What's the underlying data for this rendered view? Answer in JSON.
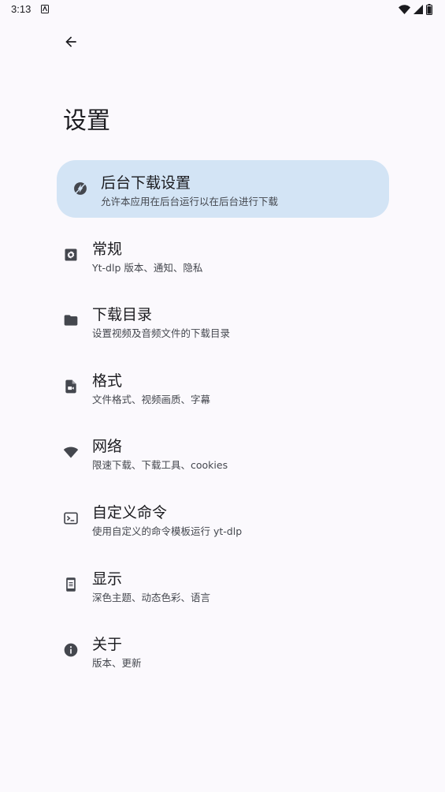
{
  "status_bar": {
    "time": "3:13"
  },
  "header": {
    "title": "设置"
  },
  "settings": [
    {
      "title": "后台下载设置",
      "description": "允许本应用在后台运行以在后台进行下载",
      "icon": "bolt-off-icon",
      "highlighted": true
    },
    {
      "title": "常规",
      "description": "Yt-dlp 版本、通知、隐私",
      "icon": "settings-gear-icon"
    },
    {
      "title": "下载目录",
      "description": "设置视频及音频文件的下载目录",
      "icon": "folder-icon"
    },
    {
      "title": "格式",
      "description": "文件格式、视频画质、字幕",
      "icon": "video-file-icon"
    },
    {
      "title": "网络",
      "description": "限速下载、下载工具、cookies",
      "icon": "wifi-icon"
    },
    {
      "title": "自定义命令",
      "description": "使用自定义的命令模板运行 yt-dlp",
      "icon": "terminal-icon"
    },
    {
      "title": "显示",
      "description": "深色主题、动态色彩、语言",
      "icon": "phone-display-icon"
    },
    {
      "title": "关于",
      "description": "版本、更新",
      "icon": "info-icon"
    }
  ],
  "colors": {
    "background": "#fbf9fd",
    "highlight": "#d3e4f5",
    "icon": "#44474e"
  }
}
